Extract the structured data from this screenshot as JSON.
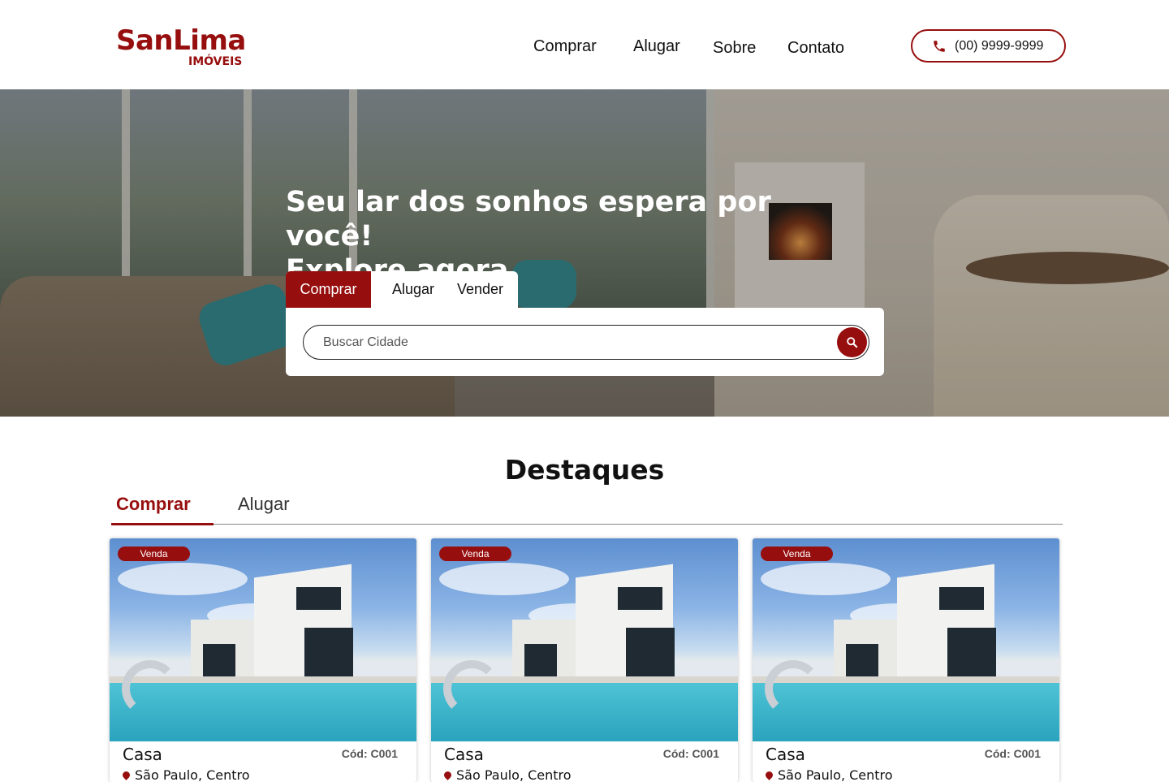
{
  "header": {
    "logo_main": "SanLima",
    "logo_sub": "IMÓVEIS",
    "nav": [
      {
        "label": "Comprar"
      },
      {
        "label": "Alugar"
      },
      {
        "label": "Sobre"
      },
      {
        "label": "Contato"
      }
    ],
    "phone": "(00) 9999-9999"
  },
  "hero": {
    "title_line1": "Seu lar dos sonhos espera por você!",
    "title_line2": "Explore agora",
    "tabs": [
      {
        "label": "Comprar",
        "active": true
      },
      {
        "label": "Alugar",
        "active": false
      },
      {
        "label": "Vender",
        "active": false
      }
    ],
    "search": {
      "placeholder": "Buscar Cidade",
      "value": ""
    }
  },
  "featured": {
    "title": "Destaques",
    "tabs": [
      {
        "label": "Comprar",
        "active": true
      },
      {
        "label": "Alugar",
        "active": false
      }
    ],
    "cards": [
      {
        "badge": "Venda",
        "type": "Casa",
        "code": "Cód: C001",
        "location": "São Paulo, Centro"
      },
      {
        "badge": "Venda",
        "type": "Casa",
        "code": "Cód: C001",
        "location": "São Paulo, Centro"
      },
      {
        "badge": "Venda",
        "type": "Casa",
        "code": "Cód: C001",
        "location": "São Paulo, Centro"
      }
    ]
  },
  "icons": {
    "phone": "phone-icon",
    "search": "search-icon",
    "location": "location-pin-icon"
  },
  "colors": {
    "brand": "#970e0e",
    "text": "#111111",
    "background": "#ffffff"
  }
}
